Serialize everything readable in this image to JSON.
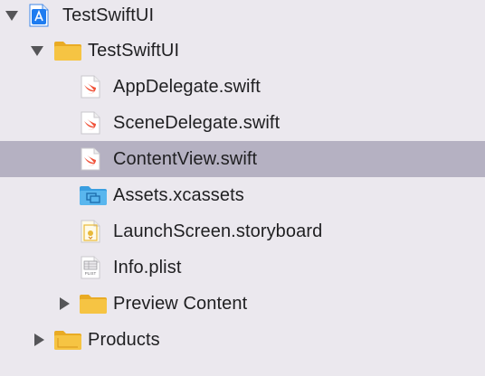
{
  "navigator": {
    "items": [
      {
        "label": "TestSwiftUI",
        "icon": "xcode-project-icon",
        "expanded": true
      },
      {
        "label": "TestSwiftUI",
        "icon": "folder-icon",
        "expanded": true
      },
      {
        "label": "AppDelegate.swift",
        "icon": "swift-file-icon"
      },
      {
        "label": "SceneDelegate.swift",
        "icon": "swift-file-icon"
      },
      {
        "label": "ContentView.swift",
        "icon": "swift-file-icon",
        "selected": true
      },
      {
        "label": "Assets.xcassets",
        "icon": "asset-catalog-folder-icon"
      },
      {
        "label": "LaunchScreen.storyboard",
        "icon": "storyboard-file-icon"
      },
      {
        "label": "Info.plist",
        "icon": "plist-file-icon",
        "badge": "PLIST"
      },
      {
        "label": "Preview Content",
        "icon": "folder-icon",
        "expanded": false
      },
      {
        "label": "Products",
        "icon": "folder-icon",
        "expanded": false
      }
    ]
  },
  "colors": {
    "selection": "#b5b1c2",
    "background": "#ebe8ee",
    "folder": "#f6c443",
    "swift": "#f05138",
    "assets": "#59b6ee",
    "project": "#1e7cf0"
  }
}
